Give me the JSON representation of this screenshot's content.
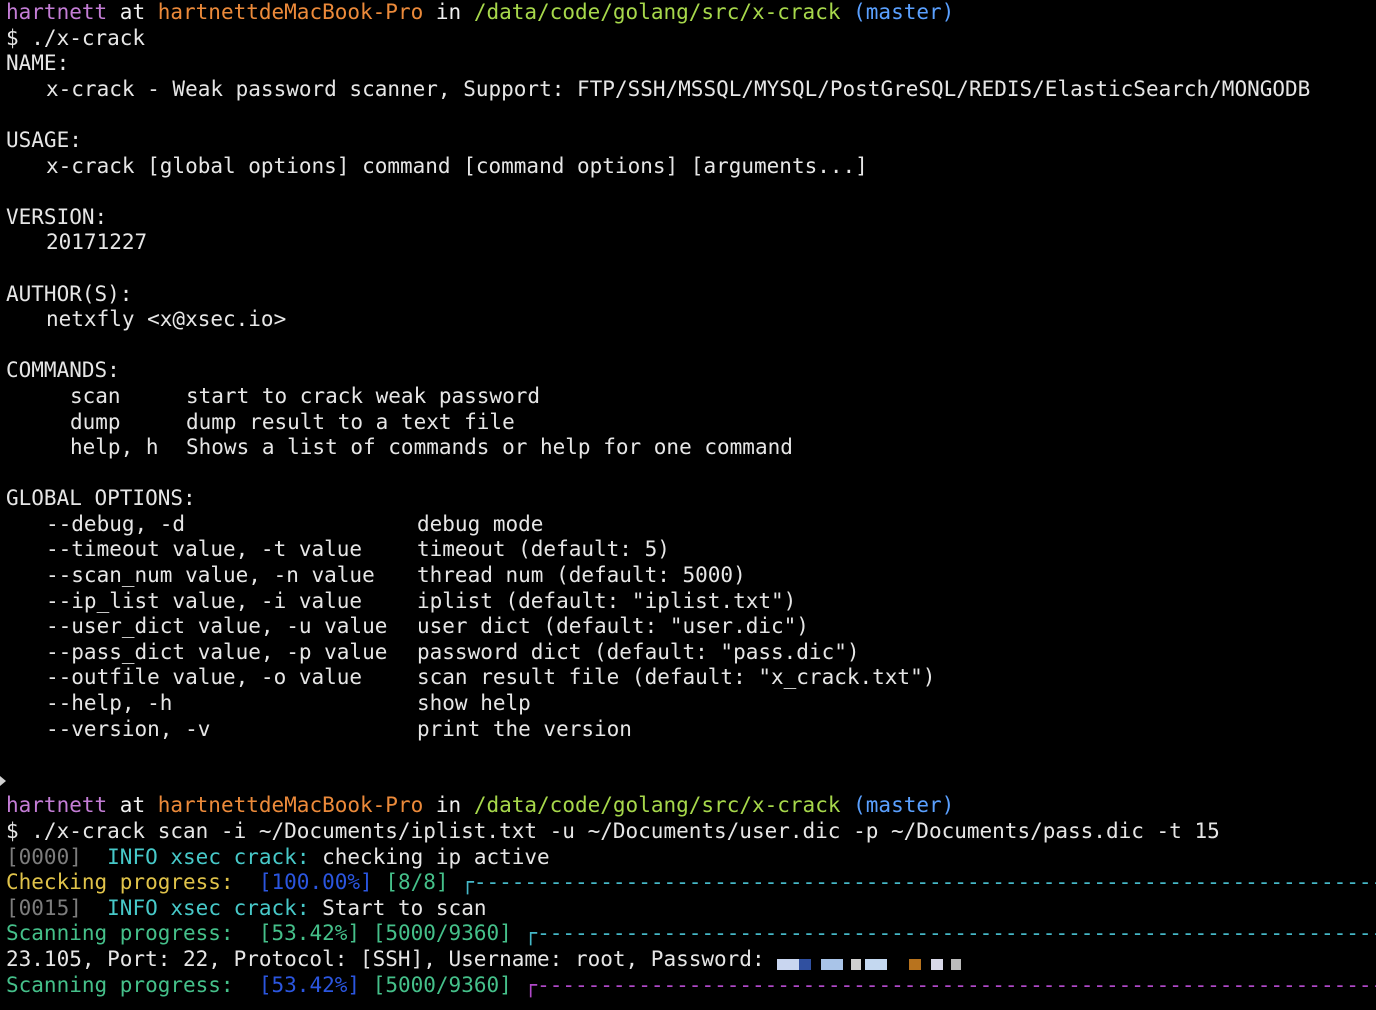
{
  "prompt1": {
    "user": "hartnett",
    "at": " at ",
    "host": "hartnettdeMacBook-Pro",
    "in": " in ",
    "path": "/data/code/golang/src/x-crack",
    "branch": "(master)"
  },
  "command1": "$ ./x-crack",
  "help": {
    "name_header": "NAME:",
    "name_text": "x-crack - Weak password scanner, Support: FTP/SSH/MSSQL/MYSQL/PostGreSQL/REDIS/ElasticSearch/MONGODB",
    "usage_header": "USAGE:",
    "usage_text": "x-crack [global options] command [command options] [arguments...]",
    "version_header": "VERSION:",
    "version_text": "20171227",
    "author_header": "AUTHOR(S):",
    "author_text": "netxfly <x@xsec.io>",
    "commands_header": "COMMANDS:",
    "commands": [
      {
        "name": "scan",
        "desc": "start to crack weak password"
      },
      {
        "name": "dump",
        "desc": "dump result to a text file"
      },
      {
        "name": "help, h",
        "desc": "Shows a list of commands or help for one command"
      }
    ],
    "global_options_header": "GLOBAL OPTIONS:",
    "options": [
      {
        "flag": "--debug, -d",
        "desc": "debug mode"
      },
      {
        "flag": "--timeout value, -t value",
        "desc": "timeout (default: 5)"
      },
      {
        "flag": "--scan_num value, -n value",
        "desc": "thread num (default: 5000)"
      },
      {
        "flag": "--ip_list value, -i value",
        "desc": "iplist (default: \"iplist.txt\")"
      },
      {
        "flag": "--user_dict value, -u value",
        "desc": "user dict (default: \"user.dic\")"
      },
      {
        "flag": "--pass_dict value, -p value",
        "desc": "password dict (default: \"pass.dic\")"
      },
      {
        "flag": "--outfile value, -o value",
        "desc": "scan result file (default: \"x_crack.txt\")"
      },
      {
        "flag": "--help, -h",
        "desc": "show help"
      },
      {
        "flag": "--version, -v",
        "desc": "print the version"
      }
    ]
  },
  "prompt2": {
    "user": "hartnett",
    "at": " at ",
    "host": "hartnettdeMacBook-Pro",
    "in": " in ",
    "path": "/data/code/golang/src/x-crack",
    "branch": "(master)"
  },
  "command2": "$ ./x-crack scan -i ~/Documents/iplist.txt -u ~/Documents/user.dic -p ~/Documents/pass.dic -t 15",
  "log": {
    "line1_tag": "[0000]",
    "line1_level": "INFO",
    "line1_src": "xsec crack:",
    "line1_msg": "checking ip active",
    "checking_label": "Checking progress:",
    "checking_pct": "[100.00%]",
    "checking_count": "[8/8]",
    "line2_tag": "[0015]",
    "line2_level": "INFO",
    "line2_src": "xsec crack:",
    "line2_msg": "Start to scan",
    "scanning_label": "Scanning progress:",
    "scanning_pct": "[53.42%]",
    "scanning_count": "[5000/9360]",
    "result_text": "23.105, Port: 22, Protocol: [SSH], Username: root, Password:",
    "scanning2_label": "Scanning progress:",
    "scanning2_pct": "[53.42%]",
    "scanning2_count": "[5000/9360]",
    "bar_corner": "┌"
  },
  "progress": {
    "checking": 1.0,
    "scanning": 0.5342
  },
  "colors": {
    "purple": "#c47dd6",
    "orange": "#ec8a3a",
    "green": "#a7d84b",
    "blue": "#5aa0ff"
  }
}
